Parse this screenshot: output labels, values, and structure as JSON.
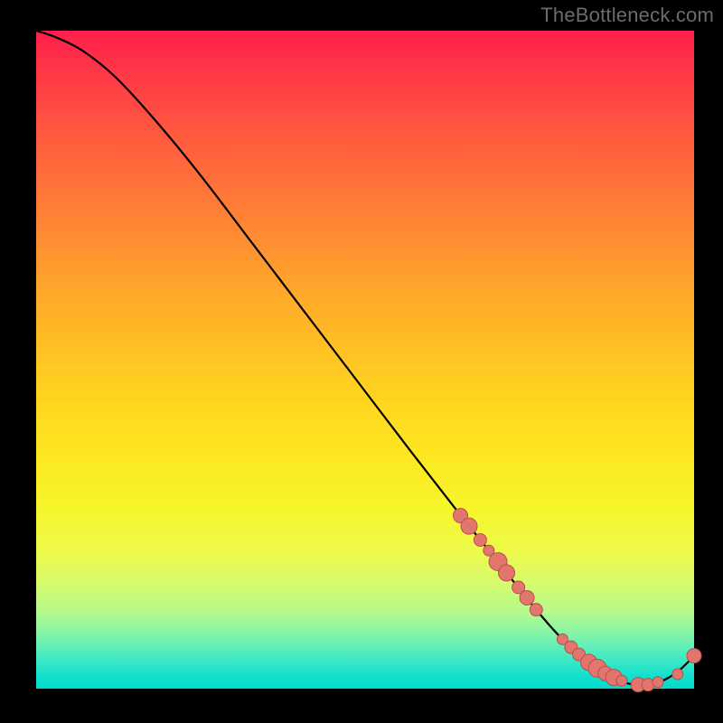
{
  "attribution": "TheBottleneck.com",
  "colors": {
    "dot_fill": "#e2766e",
    "dot_stroke": "#b84f47",
    "curve": "#000000"
  },
  "chart_data": {
    "type": "line",
    "title": "",
    "xlabel": "",
    "ylabel": "",
    "xlim": [
      0,
      100
    ],
    "ylim": [
      0,
      100
    ],
    "grid": false,
    "curve": [
      {
        "x": 0,
        "y": 100
      },
      {
        "x": 3,
        "y": 99
      },
      {
        "x": 7,
        "y": 97.0
      },
      {
        "x": 12,
        "y": 93.0
      },
      {
        "x": 18,
        "y": 86.5
      },
      {
        "x": 25,
        "y": 78.0
      },
      {
        "x": 33,
        "y": 67.5
      },
      {
        "x": 41,
        "y": 57.0
      },
      {
        "x": 49,
        "y": 46.5
      },
      {
        "x": 57,
        "y": 36.0
      },
      {
        "x": 64,
        "y": 27.0
      },
      {
        "x": 70,
        "y": 19.5
      },
      {
        "x": 76,
        "y": 12.0
      },
      {
        "x": 80,
        "y": 7.5
      },
      {
        "x": 84,
        "y": 4.0
      },
      {
        "x": 88,
        "y": 1.5
      },
      {
        "x": 91,
        "y": 0.6
      },
      {
        "x": 94,
        "y": 0.8
      },
      {
        "x": 96,
        "y": 1.6
      },
      {
        "x": 98,
        "y": 3.0
      },
      {
        "x": 100,
        "y": 5.0
      }
    ],
    "markers": [
      {
        "x": 64.5,
        "y": 26.3,
        "r": 8
      },
      {
        "x": 65.8,
        "y": 24.7,
        "r": 9
      },
      {
        "x": 67.5,
        "y": 22.6,
        "r": 7
      },
      {
        "x": 68.8,
        "y": 21.0,
        "r": 6
      },
      {
        "x": 70.2,
        "y": 19.3,
        "r": 10
      },
      {
        "x": 71.5,
        "y": 17.6,
        "r": 9
      },
      {
        "x": 73.3,
        "y": 15.4,
        "r": 7
      },
      {
        "x": 74.6,
        "y": 13.8,
        "r": 8
      },
      {
        "x": 76.0,
        "y": 12.0,
        "r": 7
      },
      {
        "x": 80.0,
        "y": 7.5,
        "r": 6
      },
      {
        "x": 81.3,
        "y": 6.3,
        "r": 7
      },
      {
        "x": 82.5,
        "y": 5.2,
        "r": 7
      },
      {
        "x": 84.0,
        "y": 4.0,
        "r": 9
      },
      {
        "x": 85.3,
        "y": 3.1,
        "r": 10
      },
      {
        "x": 86.5,
        "y": 2.3,
        "r": 8
      },
      {
        "x": 87.8,
        "y": 1.7,
        "r": 9
      },
      {
        "x": 89.0,
        "y": 1.2,
        "r": 6
      },
      {
        "x": 91.5,
        "y": 0.6,
        "r": 8
      },
      {
        "x": 93.0,
        "y": 0.6,
        "r": 7
      },
      {
        "x": 94.5,
        "y": 1.0,
        "r": 6
      },
      {
        "x": 97.5,
        "y": 2.2,
        "r": 6
      },
      {
        "x": 100.0,
        "y": 5.0,
        "r": 8
      }
    ]
  }
}
